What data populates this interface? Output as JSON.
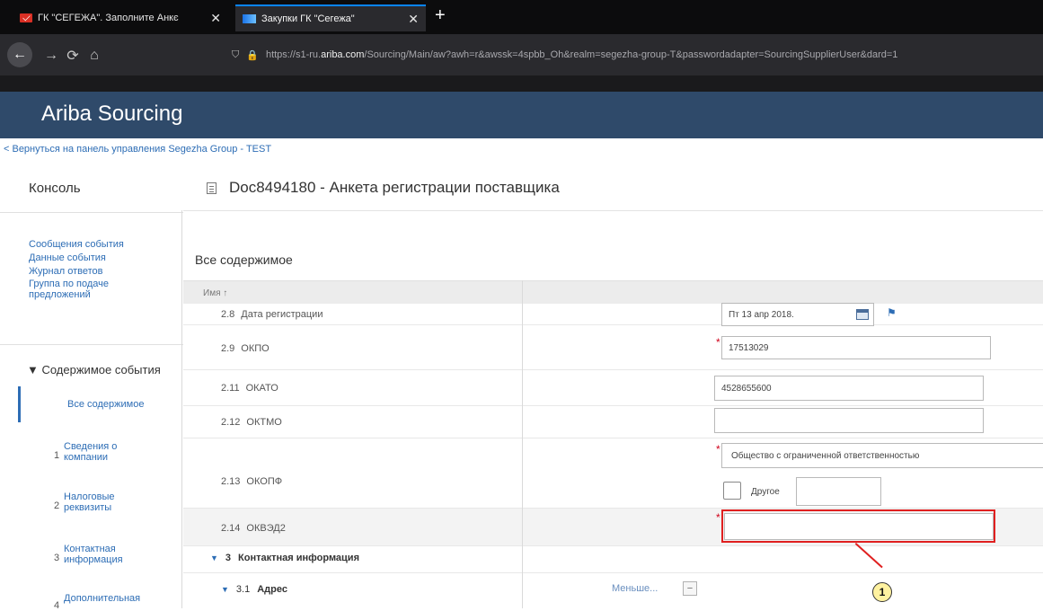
{
  "browser": {
    "tabs": [
      {
        "title": "ГК \"СЕГЕЖА\". Заполните Анкє",
        "close": "✕"
      },
      {
        "title": "Закупки ГК \"Сегежа\"",
        "close": "✕"
      }
    ],
    "new_tab": "+",
    "url_prefix": "https://s1-ru.",
    "url_host": "ariba.com",
    "url_rest": "/Sourcing/Main/aw?awh=r&awssk=4spbb_Oh&realm=segezha-group-T&passwordadapter=SourcingSupplierUser&dard=1"
  },
  "app": {
    "title": "Ariba Sourcing",
    "back_link": "< Вернуться на панель управления Segezha Group - TEST"
  },
  "sidebar": {
    "console": "Консоль",
    "links": [
      "Сообщения события",
      "Данные события",
      "Журнал ответов",
      "Группа по подаче",
      "предложений"
    ],
    "section": "▼ Содержимое события",
    "items": [
      {
        "num": "",
        "label": "Все содержимое"
      },
      {
        "num": "1",
        "label1": "Сведения о",
        "label2": "компании"
      },
      {
        "num": "2",
        "label1": "Налоговые",
        "label2": "реквизиты"
      },
      {
        "num": "3",
        "label1": "Контактная",
        "label2": "информация"
      },
      {
        "num": "4",
        "label1": "Дополнительная",
        "label2": ""
      }
    ]
  },
  "main": {
    "doc_title": "Doc8494180 - Анкета регистрации поставщика",
    "heading": "Все содержимое",
    "column_name": "Имя ↑",
    "rows": [
      {
        "num": "2.8",
        "label": "Дата регистрации",
        "value": "Пт 13 апр 2018."
      },
      {
        "num": "2.9",
        "label": "ОКПО",
        "value": "17513029"
      },
      {
        "num": "2.11",
        "label": "ОКАТО",
        "value": "4528655600"
      },
      {
        "num": "2.12",
        "label": "ОКТМО",
        "value": ""
      },
      {
        "num": "2.13",
        "label": "ОКОПФ",
        "value": "Общество с ограниченной ответственностью",
        "other_label": "Другое"
      },
      {
        "num": "2.14",
        "label": "ОКВЭД2",
        "value": ""
      }
    ],
    "section3": {
      "num": "3",
      "label": "Контактная информация"
    },
    "section31": {
      "num": "3.1",
      "label": "Адрес",
      "less": "Меньше...",
      "less_btn": "−"
    },
    "callout": "1"
  }
}
